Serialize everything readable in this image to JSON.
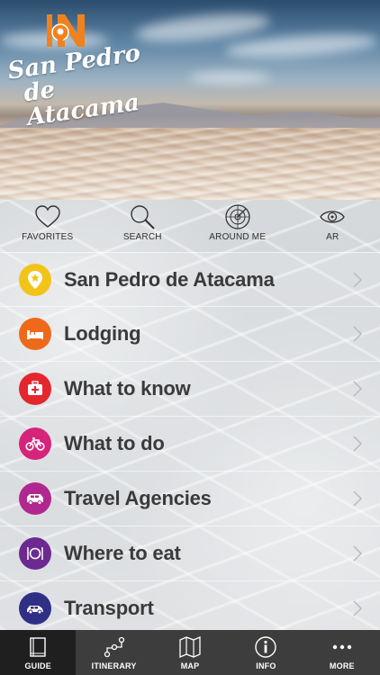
{
  "app": {
    "logo_line1": "San Pedro",
    "logo_line2": "de Atacama",
    "logo_badge": "IN"
  },
  "quick_actions": [
    {
      "label": "FAVORITES",
      "icon": "heart-icon"
    },
    {
      "label": "SEARCH",
      "icon": "search-icon"
    },
    {
      "label": "AROUND ME",
      "icon": "radar-icon"
    },
    {
      "label": "AR",
      "icon": "eye-icon"
    }
  ],
  "menu": [
    {
      "label": "San Pedro de Atacama",
      "icon": "star-pin-icon",
      "color": "#f2c418"
    },
    {
      "label": "Lodging",
      "icon": "bed-icon",
      "color": "#ee6a1a"
    },
    {
      "label": "What to know",
      "icon": "first-aid-icon",
      "color": "#e4262f"
    },
    {
      "label": "What to do",
      "icon": "bicycle-icon",
      "color": "#d6247a"
    },
    {
      "label": "Travel Agencies",
      "icon": "van-icon",
      "color": "#b0278f"
    },
    {
      "label": "Where to eat",
      "icon": "plate-icon",
      "color": "#6c2a90"
    },
    {
      "label": "Transport",
      "icon": "car-icon",
      "color": "#2f2f86"
    }
  ],
  "tabs": [
    {
      "label": "GUIDE",
      "icon": "book-icon",
      "active": true
    },
    {
      "label": "ITINERARY",
      "icon": "route-icon",
      "active": false
    },
    {
      "label": "MAP",
      "icon": "map-icon",
      "active": false
    },
    {
      "label": "INFO",
      "icon": "info-icon",
      "active": false
    },
    {
      "label": "MORE",
      "icon": "more-icon",
      "active": false
    }
  ],
  "colors": {
    "logo_orange": "#f0821e",
    "tabbar_bg": "#3d3d3d",
    "tab_active_bg": "#1f1f1f"
  }
}
